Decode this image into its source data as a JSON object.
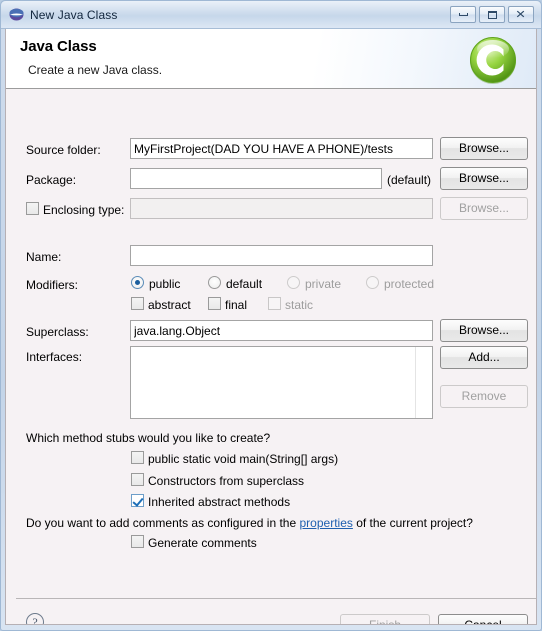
{
  "window": {
    "title": "New Java Class",
    "app_icon": "eclipse-sphere-icon",
    "buttons": {
      "minimize": "minimize-icon",
      "maximize": "maximize-icon",
      "close": "close-icon"
    }
  },
  "header": {
    "title": "Java Class",
    "subtitle": "Create a new Java class.",
    "logo": "java-class-wizard-icon",
    "logo_letter": "C",
    "logo_color": "#7dc832"
  },
  "form": {
    "source_folder": {
      "label": "Source folder:",
      "value": "MyFirstProject(DAD YOU HAVE A PHONE)/tests",
      "browse": "Browse..."
    },
    "package": {
      "label": "Package:",
      "value": "",
      "hint": "(default)",
      "browse": "Browse..."
    },
    "enclosing_type": {
      "label": "Enclosing type:",
      "checked": false,
      "value": "",
      "browse": "Browse...",
      "enabled": false
    },
    "name": {
      "label": "Name:",
      "value": ""
    },
    "modifiers": {
      "label": "Modifiers:",
      "access": [
        {
          "label": "public",
          "selected": true,
          "enabled": true
        },
        {
          "label": "default",
          "selected": false,
          "enabled": true
        },
        {
          "label": "private",
          "selected": false,
          "enabled": false
        },
        {
          "label": "protected",
          "selected": false,
          "enabled": false
        }
      ],
      "flags": [
        {
          "label": "abstract",
          "checked": false,
          "enabled": true
        },
        {
          "label": "final",
          "checked": false,
          "enabled": true
        },
        {
          "label": "static",
          "checked": false,
          "enabled": false
        }
      ]
    },
    "superclass": {
      "label": "Superclass:",
      "value": "java.lang.Object",
      "browse": "Browse..."
    },
    "interfaces": {
      "label": "Interfaces:",
      "items": [],
      "add": "Add...",
      "remove": "Remove"
    },
    "stubs": {
      "question": "Which method stubs would you like to create?",
      "options": [
        {
          "label": "public static void main(String[] args)",
          "checked": false
        },
        {
          "label": "Constructors from superclass",
          "checked": false
        },
        {
          "label": "Inherited abstract methods",
          "checked": true
        }
      ]
    },
    "comments": {
      "question_before": "Do you want to add comments as configured in the ",
      "link": "properties",
      "question_after": " of the current project?",
      "option": {
        "label": "Generate comments",
        "checked": false
      }
    }
  },
  "footer": {
    "help": "?",
    "finish": "Finish",
    "finish_enabled": false,
    "cancel": "Cancel",
    "cancel_enabled": true
  }
}
